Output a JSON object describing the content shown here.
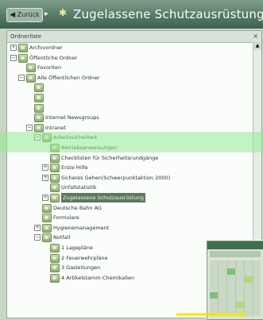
{
  "window": {
    "back_label": "Zurück",
    "title": "Zugelassene Schutzausrüstung"
  },
  "pane": {
    "header": "Ordnerliste",
    "close": "×"
  },
  "tree": [
    {
      "label": "Archivordner",
      "level": 0,
      "expander": "+"
    },
    {
      "label": "Öffentliche Ordner",
      "level": 0,
      "expander": "−"
    },
    {
      "label": "Favoriten",
      "level": 1,
      "expander": ""
    },
    {
      "label": "Alle Öffentlichen Ordner",
      "level": 1,
      "expander": "−"
    },
    {
      "label": "",
      "level": 2,
      "expander": ""
    },
    {
      "label": "",
      "level": 2,
      "expander": ""
    },
    {
      "label": "",
      "level": 2,
      "expander": ""
    },
    {
      "label": "Internet Newsgroups",
      "level": 2,
      "expander": ""
    },
    {
      "label": "Intranet",
      "level": 2,
      "expander": "−"
    },
    {
      "label": "Arbeitssicherheit",
      "level": 3,
      "expander": "−"
    },
    {
      "label": "Betriebsanweisungen",
      "level": 4,
      "expander": ""
    },
    {
      "label": "Checklisten für Sicherheitsrundgänge",
      "level": 4,
      "expander": ""
    },
    {
      "label": "Erste Hilfe",
      "level": 4,
      "expander": "+"
    },
    {
      "label": "Sicheres Gehen(Schwerpunktaktion 2000)",
      "level": 4,
      "expander": "+"
    },
    {
      "label": "Unfallstatistik",
      "level": 4,
      "expander": ""
    },
    {
      "label": "Zugelassene Schutzausrüstung",
      "level": 4,
      "expander": "+",
      "selected": true
    },
    {
      "label": "Deutsche Bahn AG",
      "level": 3,
      "expander": ""
    },
    {
      "label": "Formulare",
      "level": 3,
      "expander": ""
    },
    {
      "label": "Hygienemanagement",
      "level": 3,
      "expander": "+"
    },
    {
      "label": "Notfall",
      "level": 3,
      "expander": "−"
    },
    {
      "label": "1 Lagepläne",
      "level": 4,
      "expander": ""
    },
    {
      "label": "2 Feuerwehrpläne",
      "level": 4,
      "expander": ""
    },
    {
      "label": "3 Gasleitungen",
      "level": 4,
      "expander": ""
    },
    {
      "label": "4 Artikelstamm-Chemikalien",
      "level": 4,
      "expander": ""
    }
  ],
  "colors": {
    "highlight": "#96eb96",
    "arrow": "#f2e600",
    "folder": "#8fae72"
  },
  "icons": {
    "back": "arrow-left-icon",
    "forward": "arrow-right-icon",
    "title": "folder-star-icon",
    "folder": "folder-icon"
  }
}
